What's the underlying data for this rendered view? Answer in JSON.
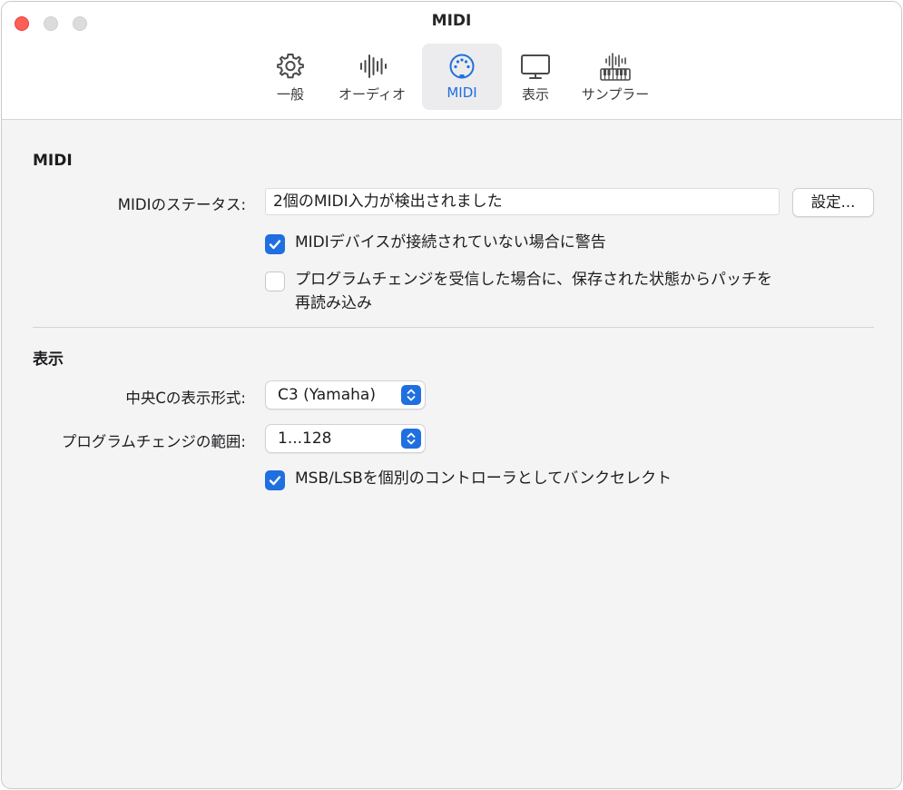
{
  "window": {
    "title": "MIDI"
  },
  "toolbar": {
    "tabs": [
      {
        "id": "general",
        "label": "一般",
        "icon": "gear-icon"
      },
      {
        "id": "audio",
        "label": "オーディオ",
        "icon": "waveform-icon"
      },
      {
        "id": "midi",
        "label": "MIDI",
        "icon": "midi-connector-icon",
        "selected": true
      },
      {
        "id": "display",
        "label": "表示",
        "icon": "display-icon"
      },
      {
        "id": "sampler",
        "label": "サンプラー",
        "icon": "sampler-keyboard-icon"
      }
    ]
  },
  "midi_section": {
    "title": "MIDI",
    "status_label": "MIDIのステータス:",
    "status_value": "2個のMIDI入力が検出されました",
    "settings_button": "設定...",
    "warn_checkbox": {
      "label": "MIDIデバイスが接続されていない場合に警告",
      "checked": true
    },
    "reload_checkbox": {
      "line1": "プログラムチェンジを受信した場合に、保存された状態からパッチを",
      "line2": "再読み込み",
      "checked": false
    }
  },
  "display_section": {
    "title": "表示",
    "middle_c_label": "中央Cの表示形式:",
    "middle_c_value": "C3 (Yamaha)",
    "program_range_label": "プログラムチェンジの範囲:",
    "program_range_value": "1...128",
    "msb_checkbox": {
      "label": "MSB/LSBを個別のコントローラとしてバンクセレクト",
      "checked": true
    }
  },
  "colors": {
    "accent": "#1f6fe0",
    "close": "#ff5f57"
  }
}
